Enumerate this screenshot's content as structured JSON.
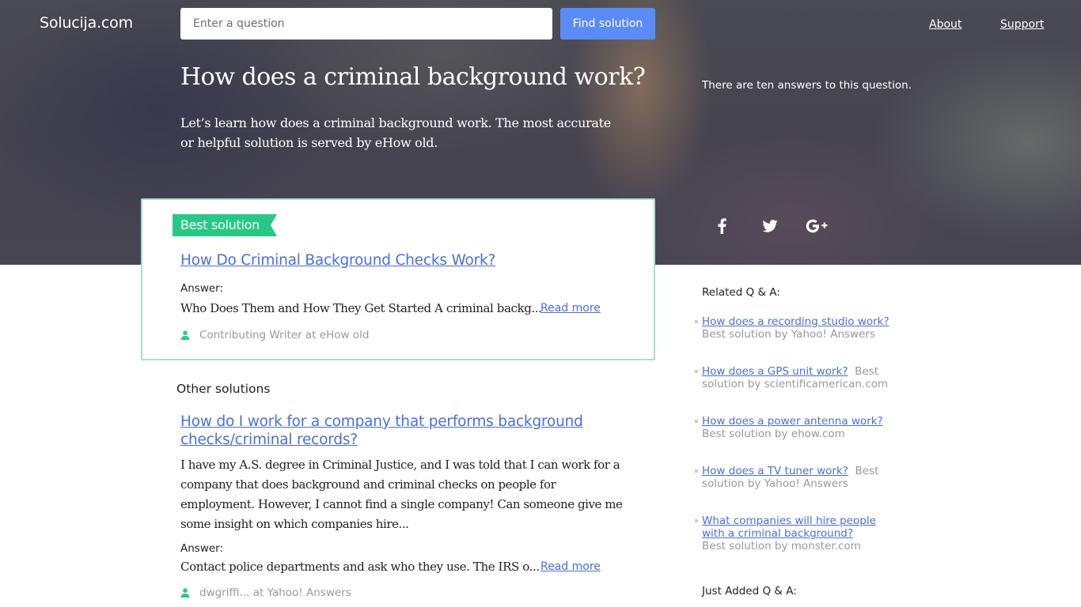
{
  "header": {
    "logo": "Solucija.com",
    "search_placeholder": "Enter a question",
    "search_value": "",
    "find_button": "Find solution",
    "nav": [
      {
        "label": "About"
      },
      {
        "label": "Support"
      }
    ]
  },
  "hero": {
    "title": "How does a criminal background work?",
    "intro": "Let’s learn how does a criminal background work. The most accurate or helpful solution is served by eHow old.",
    "answer_count": "There are ten answers to this question.",
    "social": [
      {
        "icon": "facebook-icon",
        "glyph": "f"
      },
      {
        "icon": "twitter-icon"
      },
      {
        "icon": "google-plus-icon",
        "glyph": "G+"
      }
    ]
  },
  "best_solution": {
    "badge": "Best solution",
    "title": "How Do Criminal Background Checks Work?",
    "answer_label": "Answer:",
    "answer": "Who Does Them and How They Get Started A criminal backg...",
    "read_more": "Read more",
    "author": "Contributing Writer at eHow old"
  },
  "other_solutions": {
    "heading": "Other solutions",
    "items": [
      {
        "title": "How do I work for a company that performs background checks/criminal records?",
        "question": "I have my A.S. degree in Criminal Justice, and I was told that I can work for a company that does background and criminal checks on people for employment. However, I cannot find a single company! Can someone give me some insight on which companies hire...",
        "answer_label": "Answer:",
        "answer": "Contact police departments and ask who they use. The IRS o...",
        "read_more": "Read more",
        "author": "dwgriffi... at Yahoo! Answers"
      }
    ]
  },
  "sidebar": {
    "related_heading": "Related Q & A:",
    "related": [
      {
        "title": "How does a recording studio work?",
        "source": "Best solution by Yahoo! Answers"
      },
      {
        "title": "How does a GPS unit work?",
        "source": "Best solution by scientificamerican.com"
      },
      {
        "title": "How does a power antenna work?",
        "source": "Best solution by ehow.com"
      },
      {
        "title": "How does a TV tuner work?",
        "source": "Best solution by Yahoo! Answers"
      },
      {
        "title": "What companies will hire people with a criminal background?",
        "source": "Best solution by monster.com"
      }
    ],
    "just_added_heading": "Just Added Q & A:"
  },
  "colors": {
    "accent_blue": "#5b8cf5",
    "link_blue": "#4a6fd9",
    "badge_green": "#27c886",
    "card_border": "#a8dfcf"
  }
}
